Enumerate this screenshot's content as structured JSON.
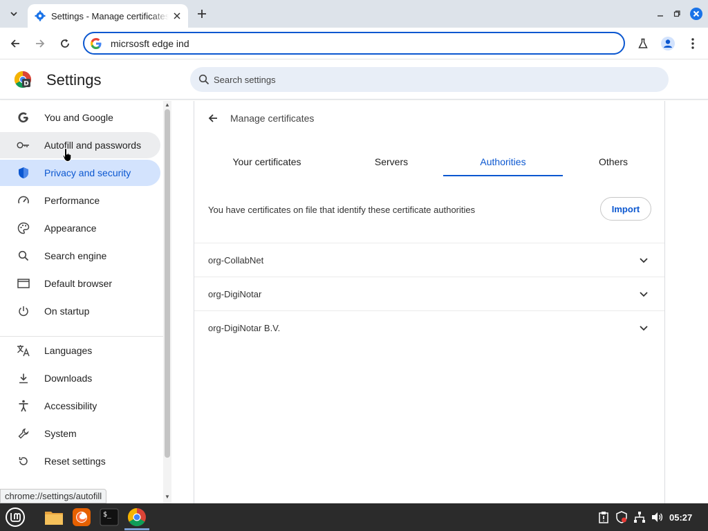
{
  "browser": {
    "tab_title": "Settings - Manage certificates",
    "omnibox_text": "micrsosft edge ind",
    "status_url": "chrome://settings/autofill"
  },
  "settings": {
    "title": "Settings",
    "search_placeholder": "Search settings"
  },
  "sidebar": {
    "items": [
      {
        "label": "You and Google",
        "icon": "google-icon"
      },
      {
        "label": "Autofill and passwords",
        "icon": "key-icon"
      },
      {
        "label": "Privacy and security",
        "icon": "shield-icon"
      },
      {
        "label": "Performance",
        "icon": "gauge-icon"
      },
      {
        "label": "Appearance",
        "icon": "palette-icon"
      },
      {
        "label": "Search engine",
        "icon": "search-icon"
      },
      {
        "label": "Default browser",
        "icon": "browser-window-icon"
      },
      {
        "label": "On startup",
        "icon": "power-icon"
      },
      {
        "label": "Languages",
        "icon": "translate-icon"
      },
      {
        "label": "Downloads",
        "icon": "download-icon"
      },
      {
        "label": "Accessibility",
        "icon": "accessibility-icon"
      },
      {
        "label": "System",
        "icon": "wrench-icon"
      },
      {
        "label": "Reset settings",
        "icon": "reset-icon"
      }
    ]
  },
  "certificates": {
    "title": "Manage certificates",
    "tabs": [
      {
        "label": "Your certificates"
      },
      {
        "label": "Servers"
      },
      {
        "label": "Authorities"
      },
      {
        "label": "Others"
      }
    ],
    "active_tab": "Authorities",
    "info_text": "You have certificates on file that identify these certificate authorities",
    "import_label": "Import",
    "entries": [
      {
        "name": "org-CollabNet"
      },
      {
        "name": "org-DigiNotar"
      },
      {
        "name": "org-DigiNotar B.V."
      }
    ]
  },
  "taskbar": {
    "clock": "05:27"
  },
  "colors": {
    "accent": "#0b57d0",
    "selected_bg": "#d3e3fd",
    "tabstrip_bg": "#dde3ea",
    "taskbar_bg": "#2b2b2b"
  }
}
